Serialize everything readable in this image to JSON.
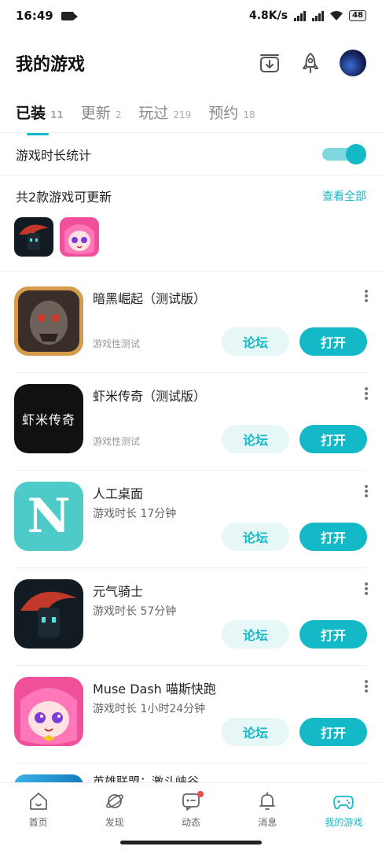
{
  "status": {
    "time": "16:49",
    "speed": "4.8K/s",
    "hd1": "HD",
    "hd2": "HD",
    "battery": "48"
  },
  "header": {
    "title": "我的游戏",
    "icons": [
      "download-box-icon",
      "rocket-icon",
      "avatar"
    ]
  },
  "tabs": [
    {
      "label": "已装",
      "count": "11",
      "active": true
    },
    {
      "label": "更新",
      "count": "2"
    },
    {
      "label": "玩过",
      "count": "219"
    },
    {
      "label": "预约",
      "count": "18"
    }
  ],
  "playtime_stats": {
    "label": "游戏时长统计",
    "enabled": true
  },
  "updates": {
    "label": "共2款游戏可更新",
    "view_all": "查看全部"
  },
  "games": [
    {
      "name": "暗黑崛起（测试版）",
      "sub": "游戏性测试",
      "forum": "论坛",
      "open": "打开"
    },
    {
      "name": "虾米传奇（测试版）",
      "sub": "游戏性测试",
      "forum": "论坛",
      "open": "打开"
    },
    {
      "name": "人工桌面",
      "sub": "游戏时长 17分钟",
      "forum": "论坛",
      "open": "打开"
    },
    {
      "name": "元气骑士",
      "sub": "游戏时长 57分钟",
      "forum": "论坛",
      "open": "打开"
    },
    {
      "name": "Muse Dash 喵斯快跑",
      "sub": "游戏时长 1小时24分钟",
      "forum": "论坛",
      "open": "打开"
    },
    {
      "name": "英雄联盟：激斗峡谷"
    }
  ],
  "icon_text": {
    "xiami": "虾米传奇",
    "n": "N"
  },
  "nav": [
    {
      "label": "首页"
    },
    {
      "label": "发现"
    },
    {
      "label": "动态"
    },
    {
      "label": "消息"
    },
    {
      "label": "我的游戏",
      "active": true
    }
  ],
  "colors": {
    "accent": "#14b9c7",
    "accent_light": "#e7f7f8",
    "badge": "#f04b4b"
  }
}
